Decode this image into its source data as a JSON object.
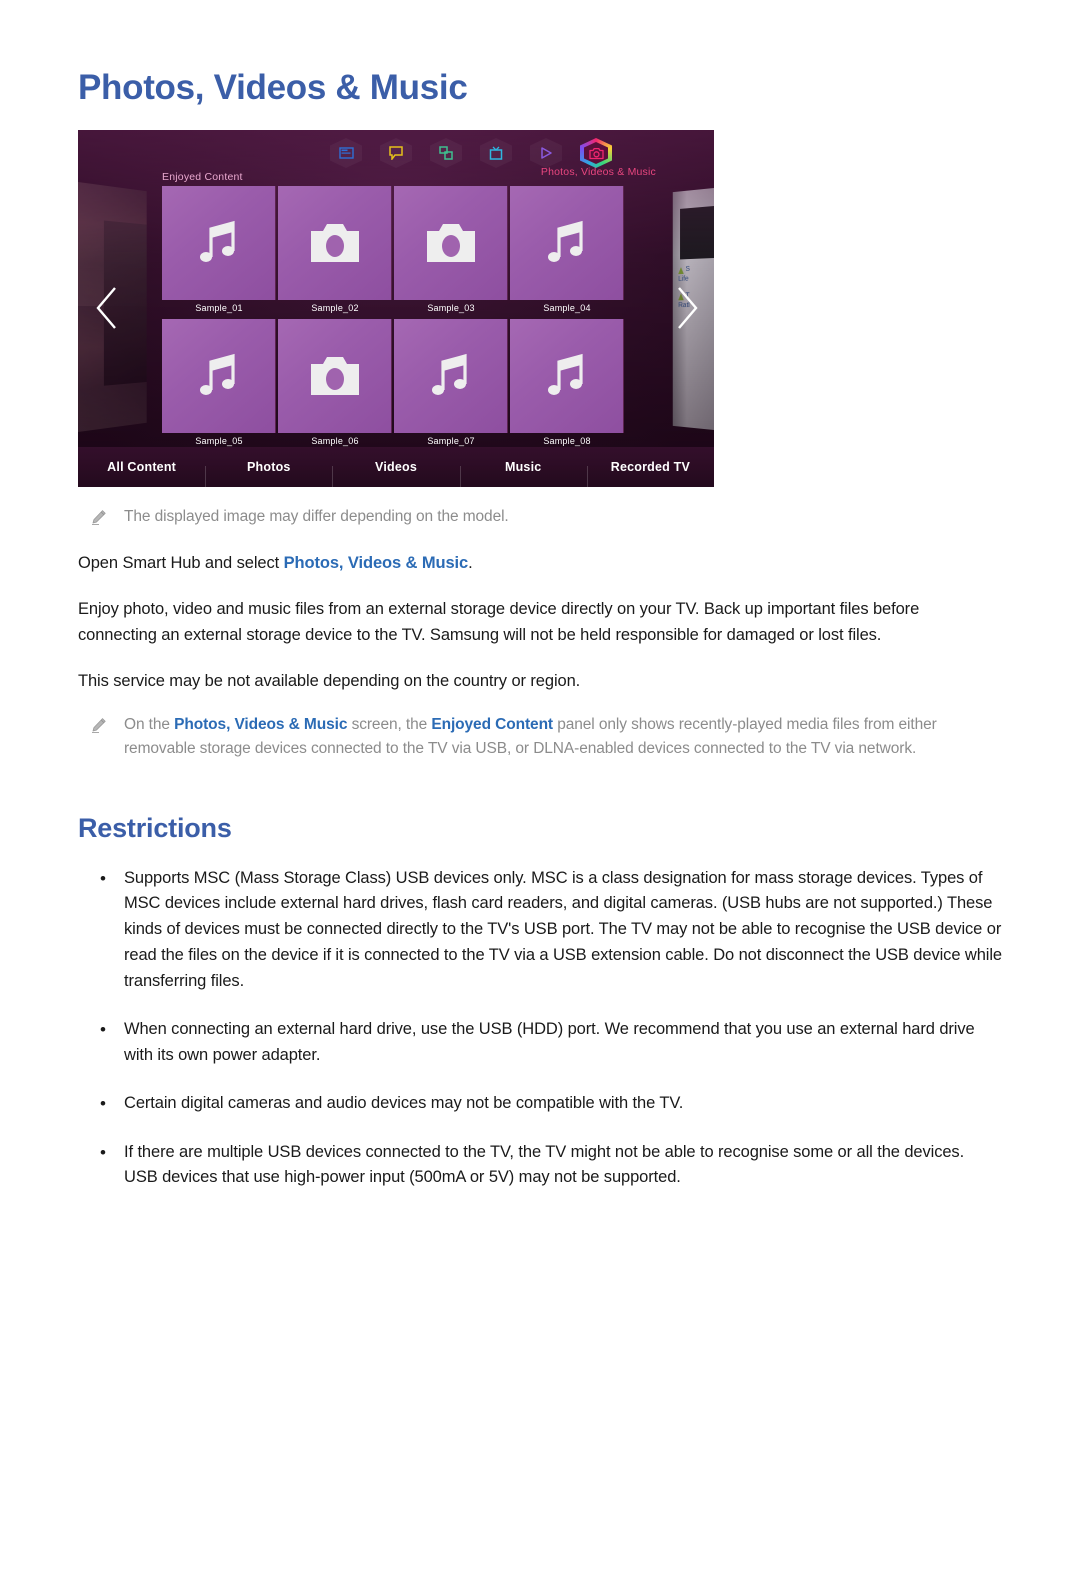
{
  "page": {
    "title": "Photos, Videos & Music"
  },
  "tv_screen": {
    "nav_icons": [
      {
        "name": "panel-icon",
        "color": "#2e6fd6"
      },
      {
        "name": "speech-bubble-icon",
        "color": "#e5c11a"
      },
      {
        "name": "apps-icon",
        "color": "#3fbf8f"
      },
      {
        "name": "tv-icon",
        "color": "#2fb6e0"
      },
      {
        "name": "play-icon",
        "color": "#8a5ae0"
      },
      {
        "name": "camera-icon",
        "color": "#f2266f"
      }
    ],
    "selected_nav_label": "Photos, Videos & Music",
    "panel_label": "Enjoyed Content",
    "tiles": [
      {
        "caption": "Sample_01",
        "icon": "music-note-icon"
      },
      {
        "caption": "Sample_02",
        "icon": "camera-icon"
      },
      {
        "caption": "Sample_03",
        "icon": "camera-icon"
      },
      {
        "caption": "Sample_04",
        "icon": "music-note-icon"
      },
      {
        "caption": "Sample_05",
        "icon": "music-note-icon"
      },
      {
        "caption": "Sample_06",
        "icon": "camera-icon"
      },
      {
        "caption": "Sample_07",
        "icon": "music-note-icon"
      },
      {
        "caption": "Sample_08",
        "icon": "music-note-icon"
      }
    ],
    "tabs": [
      {
        "label": "All Content"
      },
      {
        "label": "Photos"
      },
      {
        "label": "Videos"
      },
      {
        "label": "Music"
      },
      {
        "label": "Recorded TV"
      }
    ],
    "side_panel_right": {
      "line1": "S",
      "line2": "Life",
      "line3": "T",
      "line4": "Ratl"
    },
    "prev_arrow": "chevron-left-icon",
    "next_arrow": "chevron-right-icon"
  },
  "notes": {
    "note1": "The displayed image may differ depending on the model.",
    "note2": {
      "part1": "On the ",
      "accent1": "Photos, Videos & Music",
      "part2": " screen, the ",
      "accent2": "Enjoyed Content",
      "part3": " panel only shows recently-played media files from either removable storage devices connected to the TV via USB, or DLNA-enabled devices connected to the TV via network."
    }
  },
  "body": {
    "intro": {
      "part1": "Open Smart Hub and select ",
      "accent": "Photos, Videos & Music",
      "part2": "."
    },
    "paragraph1": "Enjoy photo, video and music files from an external storage device directly on your TV. Back up important files before connecting an external storage device to the TV. Samsung will not be held responsible for damaged or lost files.",
    "paragraph2": "This service may be not available depending on the country or region."
  },
  "restrictions": {
    "heading": "Restrictions",
    "bullet_marker": "•",
    "items": [
      "Supports MSC (Mass Storage Class) USB devices only. MSC is a class designation for mass storage devices. Types of MSC devices include external hard drives, flash card readers, and digital cameras. (USB hubs are not supported.) These kinds of devices must be connected directly to the TV's USB port. The TV may not be able to recognise the USB device or read the files on the device if it is connected to the TV via a USB extension cable. Do not disconnect the USB device while transferring files.",
      "When connecting an external hard drive, use the USB (HDD) port. We recommend that you use an external hard drive with its own power adapter.",
      "Certain digital cameras and audio devices may not be compatible with the TV.",
      "If there are multiple USB devices connected to the TV, the TV might not be able to recognise some or all the devices. USB devices that use high-power input (500mA or 5V) may not be supported."
    ]
  },
  "colors": {
    "heading_blue": "#3b5ea8",
    "accent_blue": "#2b6bb5",
    "note_grey": "#8c8c8c",
    "tile_purple": "#9a5cab",
    "tv_label_pink": "#e8467f"
  }
}
